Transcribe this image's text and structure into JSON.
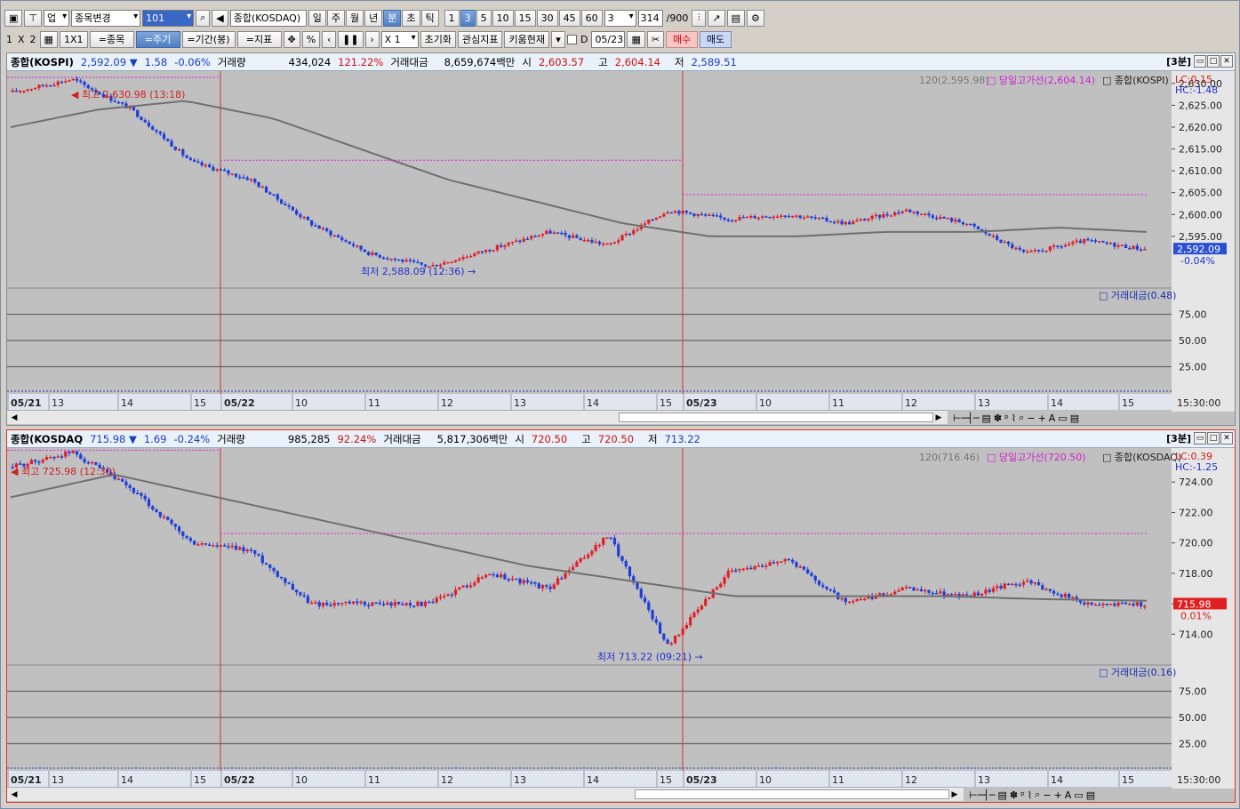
{
  "toolbar1": {
    "market_select": "업",
    "change_label": "종목변경",
    "code": "101",
    "index_name": "종합(KOSDAQ)",
    "periods": [
      "일",
      "주",
      "월",
      "년",
      "분",
      "초",
      "틱"
    ],
    "active_period": "분",
    "intervals": [
      "1",
      "3",
      "5",
      "10",
      "15",
      "30",
      "45",
      "60"
    ],
    "active_interval": "3",
    "interval_select": "3",
    "count": "314",
    "count_max": "/900"
  },
  "toolbar2": {
    "layout_1": "1",
    "layout_x": "X",
    "layout_2": "2",
    "layout_1x1": "1X1",
    "btn_stock": "=종목",
    "btn_period": "=주기",
    "btn_range": "=기간(봉)",
    "btn_indicator": "=지표",
    "zoom": "X 1",
    "btn_reset": "초기화",
    "btn_watch": "관심지표",
    "btn_kiwoom": "키움현재",
    "d_label": "D",
    "date": "05/23",
    "btn_buy": "매수",
    "btn_sell": "매도"
  },
  "panel1": {
    "name": "종합(KOSPI)",
    "price": "2,592.09 ▼",
    "change": "1.58",
    "pct": "-0.06%",
    "vol_label": "거래량",
    "vol": "434,024",
    "vol_pct": "121.22%",
    "amt_label": "거래대금",
    "amt": "8,659,674백만",
    "open_label": "시",
    "open": "2,603.57",
    "high_label": "고",
    "high": "2,604.14",
    "low_label": "저",
    "low": "2,589.51",
    "interval_tag": "[3분]",
    "legend_ma": "120(2,595.98)",
    "legend_hi": "당일고가선(2,604.14)",
    "legend_name": "종합(KOSPI)",
    "lc": "LC:0.15",
    "hc": "HC:-1.48",
    "price_tag": "2,592.09",
    "pct_tag": "-0.04%",
    "high_note": "최고 2,630.98 (13:18)",
    "low_note": "최저 2,588.09 (12:36)",
    "sub_legend": "거래대금(0.48)",
    "y_ticks": [
      "2,630.00",
      "2,625.00",
      "2,620.00",
      "2,615.00",
      "2,610.00",
      "2,605.00",
      "2,600.00",
      "2,595.00"
    ],
    "sub_ticks": [
      "75.00",
      "50.00",
      "25.00"
    ],
    "time_end": "15:30:00"
  },
  "panel2": {
    "name": "종합(KOSDAQ",
    "price": "715.98 ▼",
    "change": "1.69",
    "pct": "-0.24%",
    "vol_label": "거래량",
    "vol": "985,285",
    "vol_pct": "92.24%",
    "amt_label": "거래대금",
    "amt": "5,817,306백만",
    "open_label": "시",
    "open": "720.50",
    "high_label": "고",
    "high": "720.50",
    "low_label": "저",
    "low": "713.22",
    "interval_tag": "[3분]",
    "legend_ma": "120(716.46)",
    "legend_hi": "당일고가선(720.50)",
    "legend_name": "종합(KOSDAQ)",
    "lc": "LC:0.39",
    "hc": "HC:-1.25",
    "price_tag": "715.98",
    "pct_tag": "0.01%",
    "high_note": "최고 725.98 (12:30)",
    "low_note": "최저 713.22 (09:21)",
    "sub_legend": "거래대금(0.16)",
    "y_ticks": [
      "724.00",
      "722.00",
      "720.00",
      "718.00",
      "716.00",
      "714.00"
    ],
    "sub_ticks": [
      "75.00",
      "50.00",
      "25.00"
    ],
    "time_end": "15:30:00"
  },
  "x_axis": {
    "labels": [
      "05/21",
      "13",
      "14",
      "15",
      "05/22",
      "10",
      "11",
      "12",
      "13",
      "14",
      "15",
      "05/23",
      "10",
      "11",
      "12",
      "13",
      "14",
      "15"
    ]
  },
  "chart_data": [
    {
      "type": "candlestick",
      "title": "종합(KOSPI)",
      "days": [
        "05/21",
        "05/22",
        "05/23"
      ],
      "series": [
        {
          "name": "종합(KOSPI)",
          "values": [
            2628,
            2630.98,
            2624,
            2612,
            2608,
            2598,
            2591,
            2588.09,
            2592,
            2596,
            2593,
            2601,
            2599,
            2600,
            2598,
            2601,
            2598,
            2591,
            2594,
            2592.09
          ]
        },
        {
          "name": "120",
          "values": [
            2620,
            2624,
            2626,
            2622,
            2615,
            2608,
            2603,
            2598,
            2595,
            2595,
            2596,
            2596,
            2597,
            2596
          ]
        }
      ],
      "ylim": [
        2585,
        2632
      ]
    },
    {
      "type": "candlestick",
      "title": "종합(KOSDAQ)",
      "days": [
        "05/21",
        "05/22",
        "05/23"
      ],
      "series": [
        {
          "name": "종합(KOSDAQ)",
          "values": [
            725,
            725.98,
            723.5,
            720,
            719.5,
            716,
            716,
            716,
            718,
            717,
            720.5,
            713.22,
            718,
            719,
            716,
            717,
            716.5,
            717.5,
            716,
            715.98
          ]
        },
        {
          "name": "120",
          "values": [
            723,
            724.5,
            723,
            721.5,
            720,
            718.5,
            717.5,
            716.5,
            716.5,
            716.5,
            716.3,
            716.2
          ]
        }
      ],
      "ylim": [
        712.5,
        726
      ]
    }
  ]
}
